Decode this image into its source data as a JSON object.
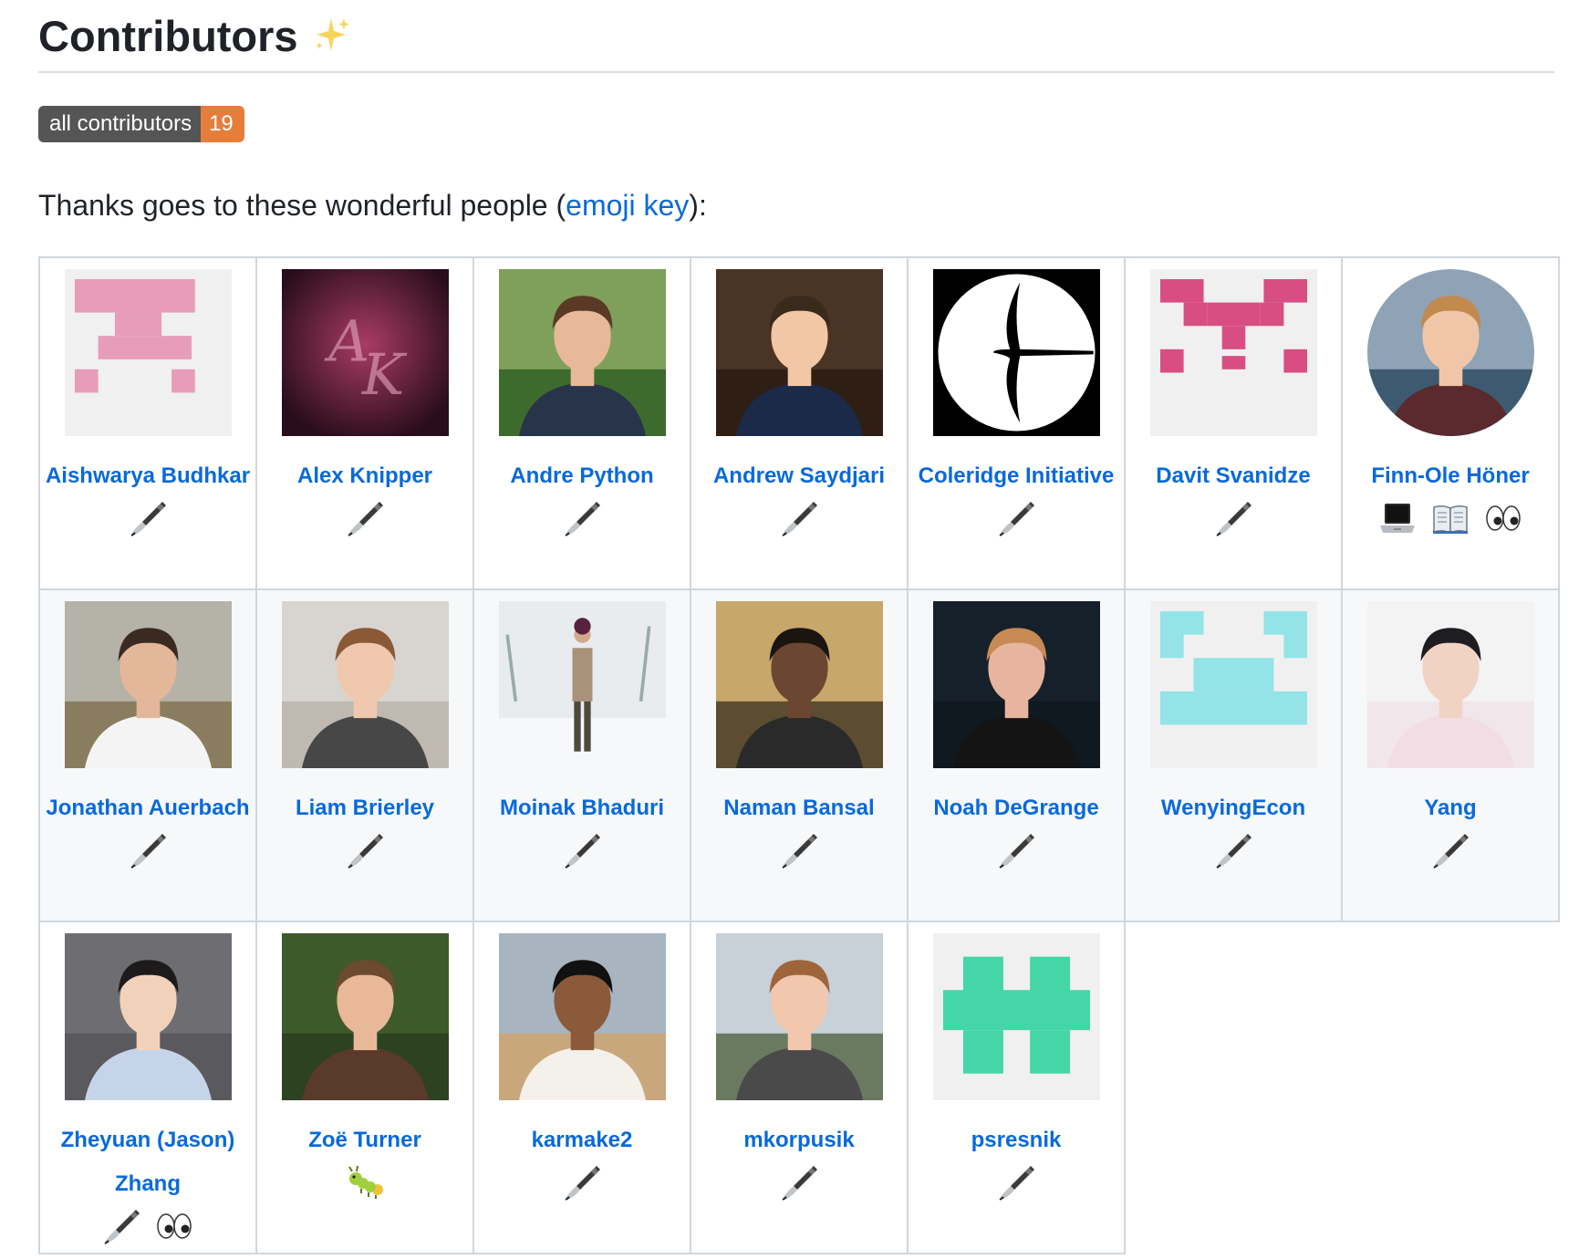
{
  "heading": "Contributors",
  "badge": {
    "label": "all contributors",
    "count": "19"
  },
  "thanks": {
    "prefix": "Thanks goes to these wonderful people (",
    "link": "emoji key",
    "suffix": "):"
  },
  "colors": {
    "link": "#0969da",
    "badge_label_bg": "#555555",
    "badge_count_bg": "#e67d3b"
  },
  "contributors": [
    {
      "name": "Aishwarya Budhkar",
      "avatar": "identicon-pink",
      "contributions": [
        "paintbrush-icon"
      ]
    },
    {
      "name": "Alex Knipper",
      "avatar": "photo-ak-monogram",
      "contributions": [
        "paintbrush-icon"
      ]
    },
    {
      "name": "Andre Python",
      "avatar": "photo",
      "contributions": [
        "paintbrush-icon"
      ]
    },
    {
      "name": "Andrew Saydjari",
      "avatar": "photo",
      "contributions": [
        "paintbrush-icon"
      ]
    },
    {
      "name": "Coleridge Initiative",
      "avatar": "logo-coleridge",
      "contributions": [
        "paintbrush-icon"
      ]
    },
    {
      "name": "Davit Svanidze",
      "avatar": "identicon-magenta",
      "contributions": [
        "paintbrush-icon"
      ]
    },
    {
      "name": "Finn-Ole Höner",
      "avatar": "photo-round",
      "contributions": [
        "laptop-icon",
        "book-icon",
        "eyes-icon"
      ]
    },
    {
      "name": "Jonathan Auerbach",
      "avatar": "photo",
      "contributions": [
        "paintbrush-icon"
      ]
    },
    {
      "name": "Liam Brierley",
      "avatar": "photo",
      "contributions": [
        "paintbrush-icon"
      ]
    },
    {
      "name": "Moinak Bhaduri",
      "avatar": "photo-snow",
      "contributions": [
        "paintbrush-icon"
      ]
    },
    {
      "name": "Naman Bansal",
      "avatar": "photo",
      "contributions": [
        "paintbrush-icon"
      ]
    },
    {
      "name": "Noah DeGrange",
      "avatar": "photo-dark",
      "contributions": [
        "paintbrush-icon"
      ]
    },
    {
      "name": "WenyingEcon",
      "avatar": "identicon-cyan",
      "contributions": [
        "paintbrush-icon"
      ]
    },
    {
      "name": "Yang",
      "avatar": "photo-light",
      "contributions": [
        "paintbrush-icon"
      ]
    },
    {
      "name": "Zheyuan (Jason) Zhang",
      "avatar": "photo",
      "contributions": [
        "paintbrush-icon",
        "eyes-icon"
      ]
    },
    {
      "name": "Zoë Turner",
      "avatar": "photo",
      "contributions": [
        "bug-icon"
      ]
    },
    {
      "name": "karmake2",
      "avatar": "photo",
      "contributions": [
        "paintbrush-icon"
      ]
    },
    {
      "name": "mkorpusik",
      "avatar": "photo",
      "contributions": [
        "paintbrush-icon"
      ]
    },
    {
      "name": "psresnik",
      "avatar": "identicon-green",
      "contributions": [
        "paintbrush-icon"
      ]
    }
  ]
}
